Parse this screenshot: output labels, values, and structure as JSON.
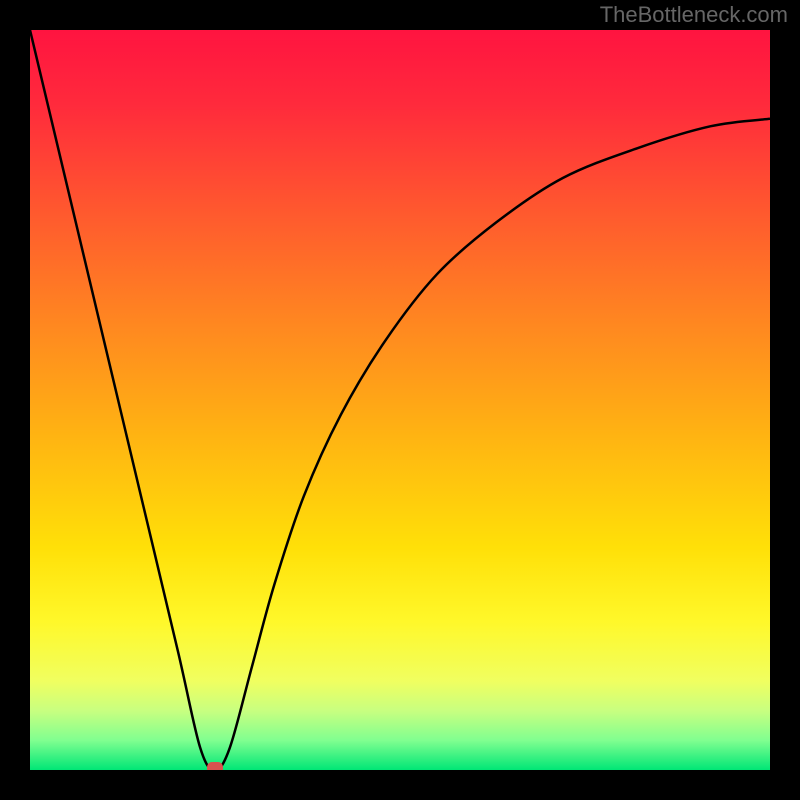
{
  "attribution": "TheBottleneck.com",
  "chart_data": {
    "type": "line",
    "title": "",
    "xlabel": "",
    "ylabel": "",
    "xlim": [
      0,
      100
    ],
    "ylim": [
      0,
      100
    ],
    "grid": false,
    "legend": false,
    "gradient_stops": [
      {
        "offset": 0.0,
        "color": "#ff1440"
      },
      {
        "offset": 0.1,
        "color": "#ff2a3c"
      },
      {
        "offset": 0.25,
        "color": "#ff5a2e"
      },
      {
        "offset": 0.4,
        "color": "#ff8820"
      },
      {
        "offset": 0.55,
        "color": "#ffb412"
      },
      {
        "offset": 0.7,
        "color": "#ffe008"
      },
      {
        "offset": 0.8,
        "color": "#fff82a"
      },
      {
        "offset": 0.88,
        "color": "#f0ff60"
      },
      {
        "offset": 0.92,
        "color": "#c8ff80"
      },
      {
        "offset": 0.96,
        "color": "#80ff90"
      },
      {
        "offset": 1.0,
        "color": "#00e676"
      }
    ],
    "series": [
      {
        "name": "bottleneck_curve",
        "x": [
          0,
          5,
          10,
          15,
          20,
          23,
          25,
          27,
          30,
          33,
          37,
          42,
          48,
          55,
          63,
          72,
          82,
          92,
          100
        ],
        "y": [
          100,
          79,
          58,
          37,
          16,
          3,
          0,
          3,
          14,
          25,
          37,
          48,
          58,
          67,
          74,
          80,
          84,
          87,
          88
        ]
      }
    ],
    "minimum_marker": {
      "x": 25,
      "y": 0,
      "color": "#d9534f"
    }
  }
}
